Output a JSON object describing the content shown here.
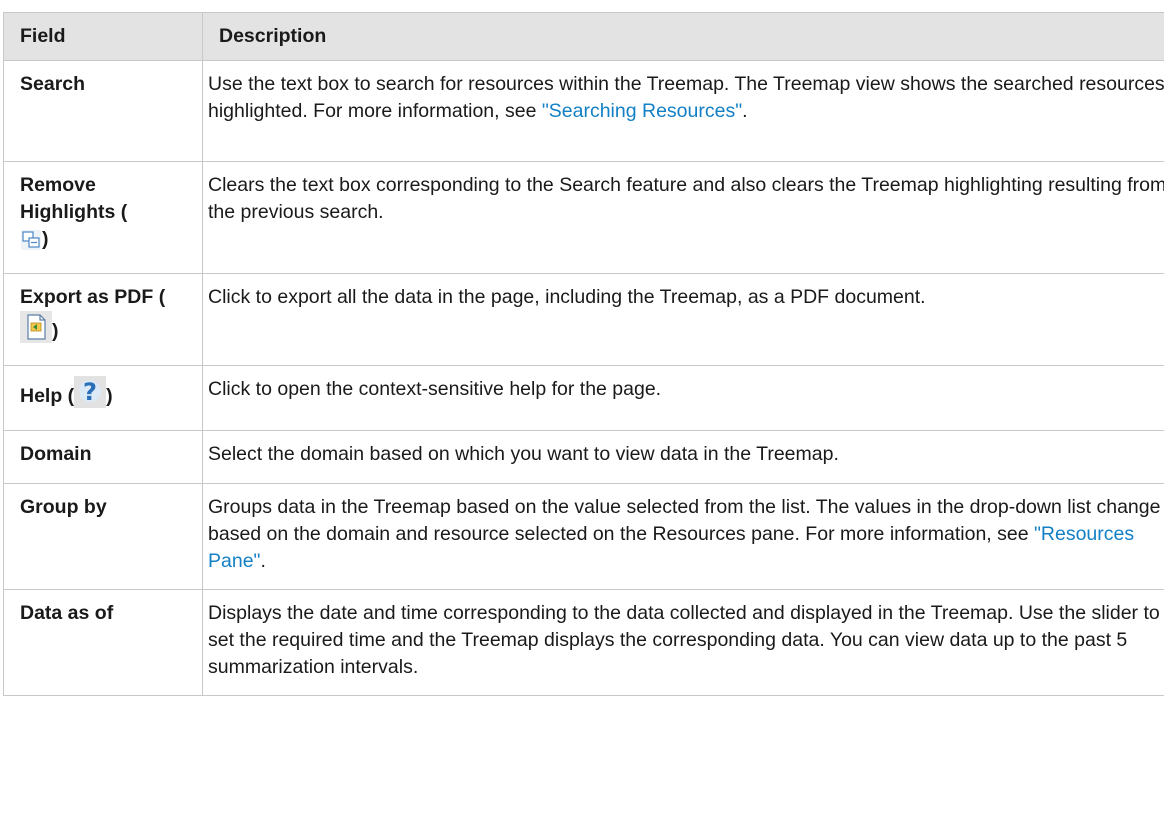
{
  "table": {
    "headers": {
      "field": "Field",
      "description": "Description"
    },
    "rows": [
      {
        "field": "Search",
        "desc_parts": [
          "Use the text box to search for resources within the Treemap. The Treemap view shows the searched resources highlighted. For more information, see ",
          "\"Searching Resources\"",
          "."
        ]
      },
      {
        "field_parts": [
          "Remove Highlights (",
          ")"
        ],
        "icon": "remove-highlights-icon",
        "desc": "Clears the text box corresponding to the Search feature and also clears the Treemap highlighting resulting from the previous search."
      },
      {
        "field_parts": [
          "Export as PDF (",
          ")"
        ],
        "icon": "export-pdf-icon",
        "desc": "Click to export all the data in the page, including the Treemap, as a PDF document."
      },
      {
        "field_parts": [
          "Help (",
          ")"
        ],
        "icon": "help-icon",
        "desc": "Click to open the context-sensitive help for the page."
      },
      {
        "field": "Domain",
        "desc": "Select the domain based on which you want to view data in the Treemap."
      },
      {
        "field": "Group by",
        "desc_parts": [
          "Groups data in the Treemap based on the value selected from the list. The values in the drop-down list change based on the domain and resource selected on the Resources pane. For more information, see ",
          "\"Resources Pane\"",
          "."
        ]
      },
      {
        "field": "Data as of",
        "desc": "Displays the date and time corresponding to the data collected and displayed in the Treemap. Use the slider to set the required time and the Treemap displays the corresponding data. You can view data up to the past 5 summarization intervals."
      }
    ]
  },
  "colors": {
    "link": "#1380c6",
    "header_bg": "#e3e3e3",
    "border": "#c8c8c8"
  }
}
